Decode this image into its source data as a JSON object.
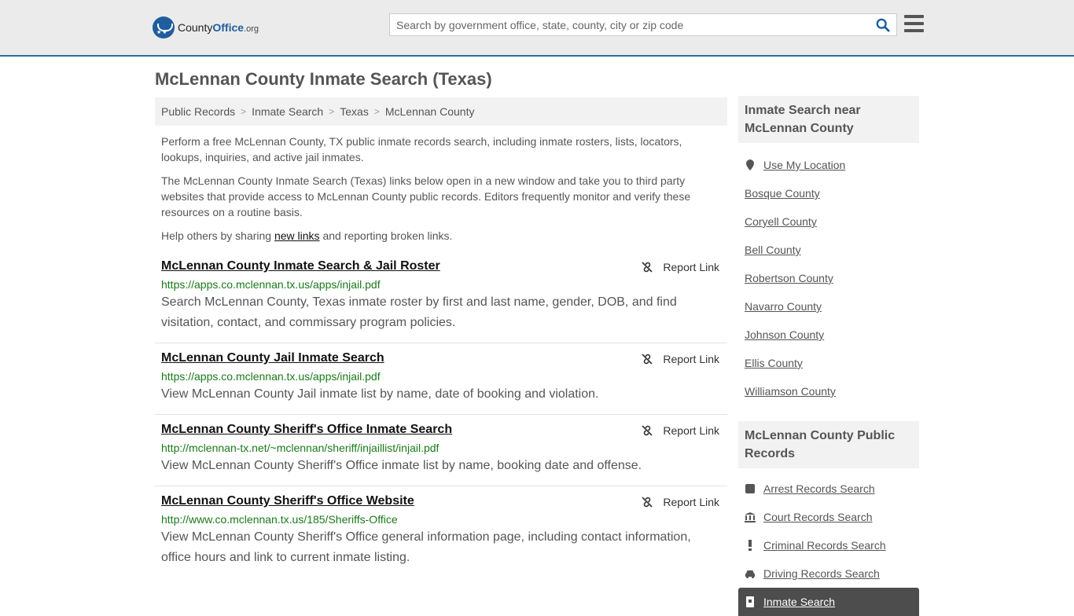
{
  "header": {
    "logo": {
      "brand": "County",
      "brand_accent": "Office",
      "tld": ".org"
    },
    "search_placeholder": "Search by government office, state, county, city or zip code"
  },
  "page_title": "McLennan County Inmate Search (Texas)",
  "breadcrumb": [
    "Public Records",
    "Inmate Search",
    "Texas",
    "McLennan County"
  ],
  "intro": {
    "p1": "Perform a free McLennan County, TX public inmate records search, including inmate rosters, lists, locators, lookups, inquiries, and active jail inmates.",
    "p2": "The McLennan County Inmate Search (Texas) links below open in a new window and take you to third party websites that provide access to McLennan County public records. Editors frequently monitor and verify these resources on a routine basis.",
    "p3_before": "Help others by sharing ",
    "p3_link": "new links",
    "p3_after": " and reporting broken links."
  },
  "report_label": "Report Link",
  "results": [
    {
      "title": "McLennan County Inmate Search & Jail Roster",
      "url": "https://apps.co.mclennan.tx.us/apps/injail.pdf",
      "desc": "Search McLennan County, Texas inmate roster by first and last name, gender, DOB, and find visitation, contact, and commissary program policies."
    },
    {
      "title": "McLennan County Jail Inmate Search",
      "url": "https://apps.co.mclennan.tx.us/apps/injail.pdf",
      "desc": "View McLennan County Jail inmate list by name, date of booking and violation."
    },
    {
      "title": "McLennan County Sheriff's Office Inmate Search",
      "url": "http://mclennan-tx.net/~mclennan/sheriff/injaillist/injail.pdf",
      "desc": "View McLennan County Sheriff's Office inmate list by name, booking date and offense."
    },
    {
      "title": "McLennan County Sheriff's Office Website",
      "url": "http://www.co.mclennan.tx.us/185/Sheriffs-Office",
      "desc": "View McLennan County Sheriff's Office general information page, including contact information, office hours and link to current inmate listing."
    }
  ],
  "sidebar": {
    "nearby_title": "Inmate Search near McLennan County",
    "use_location": "Use My Location",
    "nearby": [
      "Bosque County",
      "Coryell County",
      "Bell County",
      "Robertson County",
      "Navarro County",
      "Johnson County",
      "Ellis County",
      "Williamson County"
    ],
    "records_title": "McLennan County Public Records",
    "records": [
      "Arrest Records Search",
      "Court Records Search",
      "Criminal Records Search",
      "Driving Records Search",
      "Inmate Search"
    ]
  },
  "colors": {
    "accent": "#1f5d9e",
    "url_green": "#1a7a1a",
    "active_bg": "#4d4d4d"
  }
}
